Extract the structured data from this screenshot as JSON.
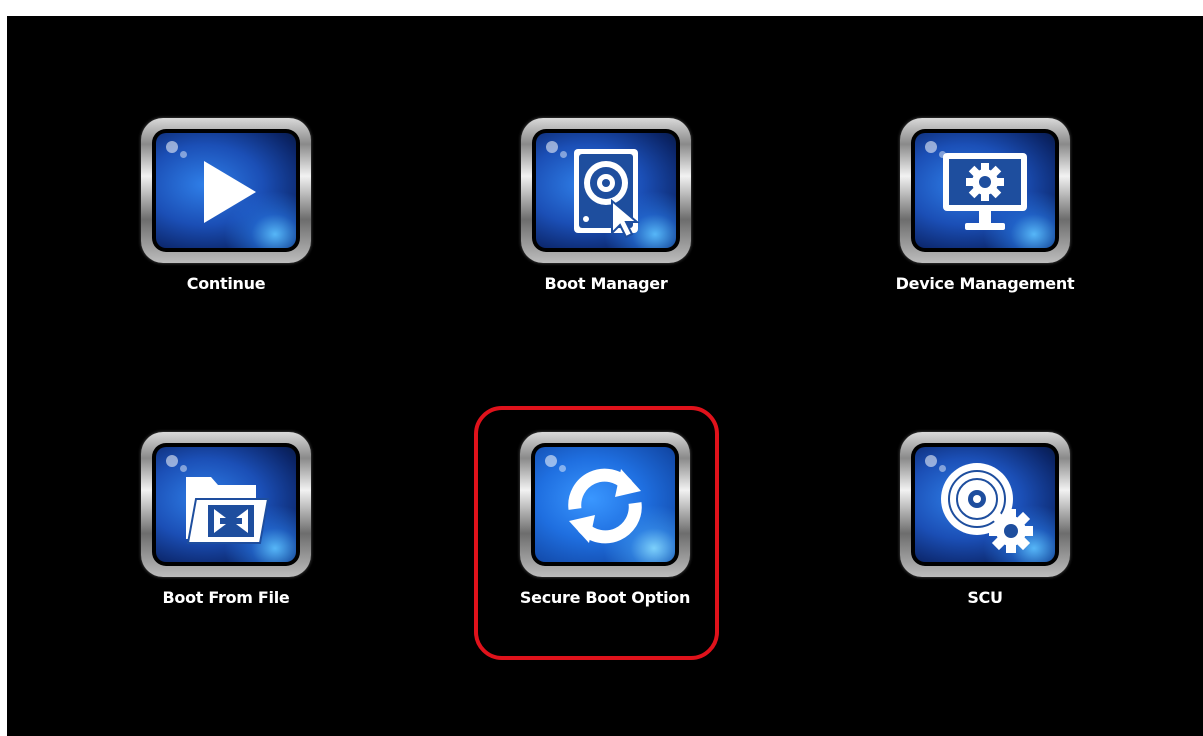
{
  "menu": {
    "items": [
      {
        "label": "Continue",
        "icon": "play-icon"
      },
      {
        "label": "Boot Manager",
        "icon": "boot-manager-icon"
      },
      {
        "label": "Device Management",
        "icon": "device-management-icon"
      },
      {
        "label": "Boot From File",
        "icon": "boot-from-file-icon"
      },
      {
        "label": "Secure Boot Option",
        "icon": "secure-boot-icon",
        "highlighted": true
      },
      {
        "label": "SCU",
        "icon": "scu-icon"
      }
    ]
  },
  "colors": {
    "background": "#000000",
    "highlight_border": "#e0121b",
    "icon_blue": "#1f6fe0",
    "label": "#ffffff"
  }
}
